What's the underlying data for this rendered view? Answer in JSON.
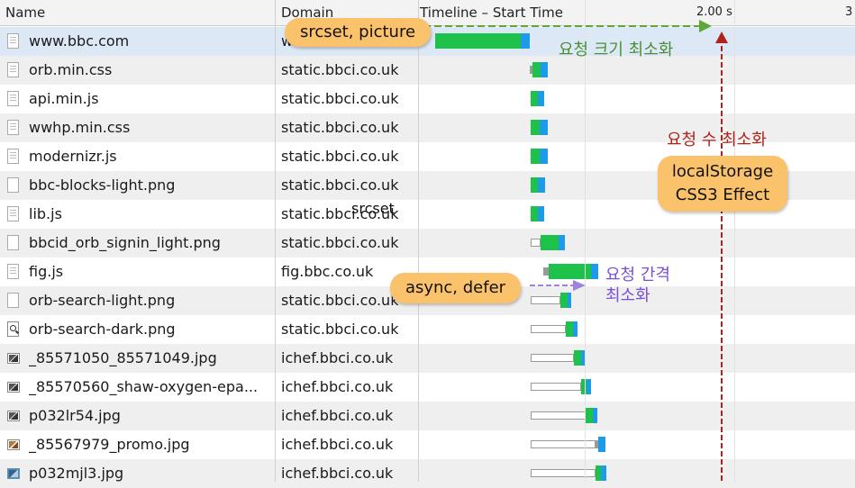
{
  "columns": {
    "name": "Name",
    "domain": "Domain",
    "timeline": "Timeline – Start Time",
    "tick_2": "2.00 s",
    "tick_3": "3"
  },
  "rows": [
    {
      "name": "www.bbc.com",
      "domain": "w",
      "icon": "document-icon"
    },
    {
      "name": "orb.min.css",
      "domain": "static.bbci.co.uk",
      "icon": "document-icon"
    },
    {
      "name": "api.min.js",
      "domain": "static.bbci.co.uk",
      "icon": "document-icon"
    },
    {
      "name": "wwhp.min.css",
      "domain": "static.bbci.co.uk",
      "icon": "document-icon"
    },
    {
      "name": "modernizr.js",
      "domain": "static.bbci.co.uk",
      "icon": "document-icon"
    },
    {
      "name": "bbc-blocks-light.png",
      "domain": "static.bbci.co.uk",
      "icon": "blank-file-icon"
    },
    {
      "name": "lib.js",
      "domain": "static.bbci.co.uk",
      "icon": "document-icon"
    },
    {
      "name": "bbcid_orb_signin_light.png",
      "domain": "static.bbci.co.uk",
      "icon": "blank-file-icon"
    },
    {
      "name": "fig.js",
      "domain": "fig.bbc.co.uk",
      "icon": "document-icon"
    },
    {
      "name": "orb-search-light.png",
      "domain": "static.bbci.co.uk",
      "icon": "blank-file-icon"
    },
    {
      "name": "orb-search-dark.png",
      "domain": "static.bbci.co.uk",
      "icon": "search-icon"
    },
    {
      "name": "_85571050_85571049.jpg",
      "domain": "ichef.bbci.co.uk",
      "icon": "image-thumb-icon"
    },
    {
      "name": "_85570560_shaw-oxygen-epa...",
      "domain": "ichef.bbci.co.uk",
      "icon": "image-thumb-icon"
    },
    {
      "name": "p032lr54.jpg",
      "domain": "ichef.bbci.co.uk",
      "icon": "image-thumb-icon"
    },
    {
      "name": "_85567979_promo.jpg",
      "domain": "ichef.bbci.co.uk",
      "icon": "image-thumb-icon"
    },
    {
      "name": "p032mjl3.jpg",
      "domain": "ichef.bbci.co.uk",
      "icon": "image-thumb-icon"
    }
  ],
  "annotations": {
    "srcset_picture": "srcset, picture",
    "request_size": "요청 크기 최소화",
    "request_count": "요청 수 최소화",
    "localstorage_line1": "localStorage",
    "localstorage_line2": "CSS3 Effect",
    "srcset": "srcset",
    "async_defer": "async, defer",
    "request_interval_line1": "요청 간격",
    "request_interval_line2": "최소화"
  },
  "colors": {
    "receive": "#1ec24b",
    "download": "#1e9be8",
    "callout": "#fbc26c",
    "note_green": "#4a8f35",
    "note_red": "#b0231a",
    "note_purple": "#7a4fd6",
    "marker_red": "#b0231a"
  }
}
